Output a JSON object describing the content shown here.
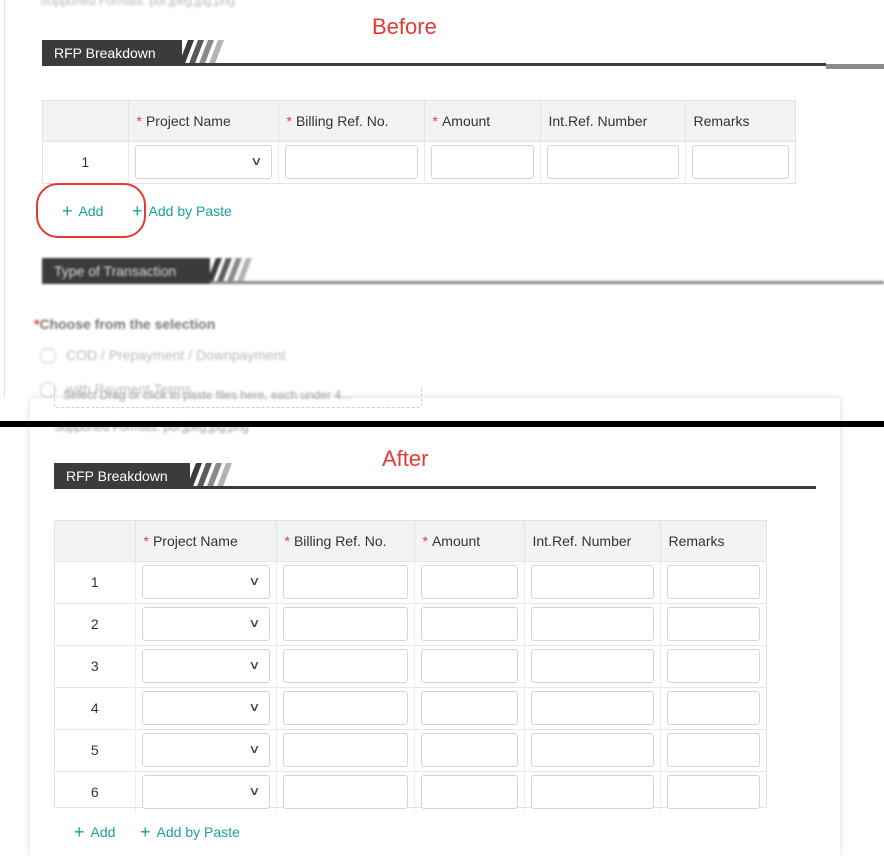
{
  "before": {
    "caption": "Before",
    "supported_formats": "Supported Formats: pdf,jpeg,jpg,png",
    "section_title": "RFP Breakdown",
    "columns": [
      {
        "label": "Project Name",
        "required": true
      },
      {
        "label": "Billing Ref. No.",
        "required": true
      },
      {
        "label": "Amount",
        "required": true
      },
      {
        "label": "Int.Ref. Number",
        "required": false
      },
      {
        "label": "Remarks",
        "required": false
      }
    ],
    "rows": [
      "1"
    ],
    "add_label": "Add",
    "add_paste_label": "Add by Paste",
    "transaction_section_title": "Type of Transaction",
    "choose_label": "Choose from the selection",
    "required_mark": "*",
    "options": [
      "COD / Prepayment / Downpayment",
      "with Payment Terms"
    ],
    "upload_hint": "Select  Drag or click to paste files here, each under 4..."
  },
  "after": {
    "caption": "After",
    "supported_formats": "Supported Formats: pdf,jpeg,jpg,png",
    "section_title": "RFP Breakdown",
    "columns": [
      {
        "label": "Project Name",
        "required": true
      },
      {
        "label": "Billing Ref. No.",
        "required": true
      },
      {
        "label": "Amount",
        "required": true
      },
      {
        "label": "Int.Ref. Number",
        "required": false
      },
      {
        "label": "Remarks",
        "required": false
      }
    ],
    "rows": [
      "1",
      "2",
      "3",
      "4",
      "5",
      "6"
    ],
    "add_label": "Add",
    "add_paste_label": "Add by Paste"
  },
  "colors": {
    "accent": "#1aa394",
    "required": "#e53935",
    "annotation": "#e53935",
    "header_bar": "#3b3b3b"
  },
  "icons": [
    "plus-icon",
    "chevron-down-icon",
    "stripes-icon"
  ]
}
